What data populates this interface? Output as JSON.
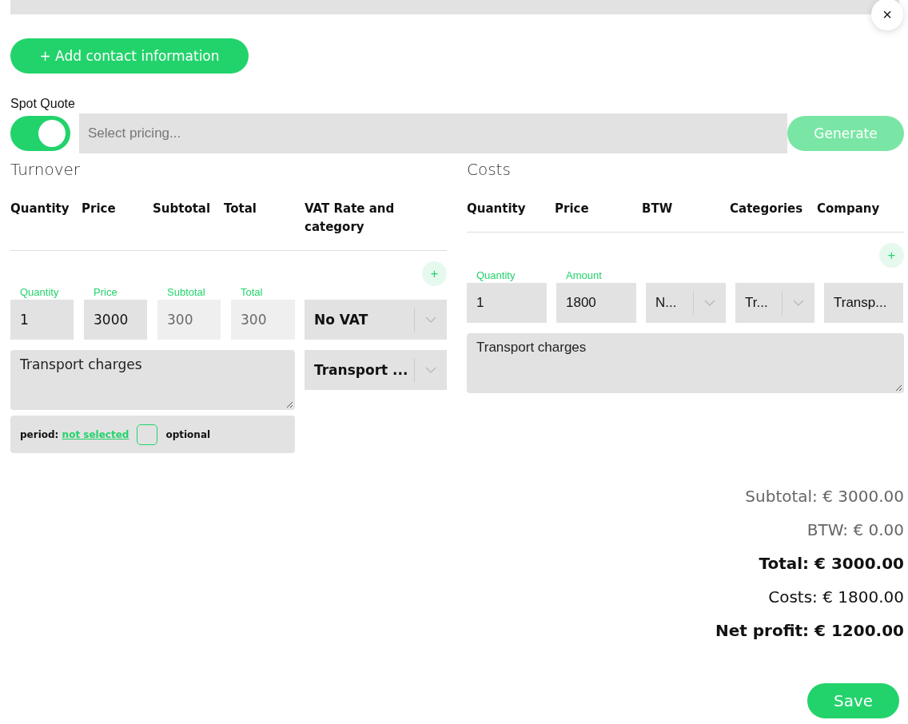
{
  "close_button": {
    "label": "×"
  },
  "add_contact_button": {
    "label": "+ Add contact information"
  },
  "spot_quote": {
    "label": "Spot Quote",
    "on": true
  },
  "pricing_select": {
    "placeholder": "Select pricing..."
  },
  "generate_button": {
    "label": "Generate",
    "disabled": true
  },
  "turnover": {
    "title": "Turnover",
    "columns": [
      "Quantity",
      "Price",
      "Subtotal",
      "Total",
      "VAT Rate and category"
    ],
    "add_button": {
      "label": "+"
    },
    "fields": [
      {
        "label": "Quantity",
        "value": "1",
        "disabled": false
      },
      {
        "label": "Price",
        "value": "3000",
        "disabled": false
      },
      {
        "label": "Subtotal",
        "value": "300",
        "disabled": true
      },
      {
        "label": "Total",
        "value": "300",
        "disabled": true
      }
    ],
    "vat_select": {
      "value": "No VAT"
    },
    "category_select": {
      "value": "Transport ..."
    },
    "description": "Transport charges",
    "period": {
      "label": "period:",
      "value": "not selected"
    },
    "optional": {
      "label": "optional",
      "checked": false
    }
  },
  "costs": {
    "title": "Costs",
    "columns": [
      "Quantity",
      "Price",
      "BTW",
      "Categories",
      "Company"
    ],
    "add_button": {
      "label": "+"
    },
    "fields": [
      {
        "kind": "input",
        "label": "Quantity",
        "value": "1"
      },
      {
        "kind": "input",
        "label": "Amount",
        "value": "1800"
      },
      {
        "kind": "select",
        "value": "N..."
      },
      {
        "kind": "select",
        "value": "Tr..."
      },
      {
        "kind": "input",
        "value": "Transp..."
      }
    ],
    "description": "Transport charges"
  },
  "summary": [
    {
      "text": "Subtotal: € 3000.00",
      "kind": "muted"
    },
    {
      "text": "BTW: € 0.00",
      "kind": "muted"
    },
    {
      "text": "Total: € 3000.00",
      "kind": "strong"
    },
    {
      "text": "Costs: € 1800.00",
      "kind": "plain"
    },
    {
      "text": "Net profit: € 1200.00",
      "kind": "strong"
    }
  ],
  "save_button": {
    "label": "Save"
  }
}
